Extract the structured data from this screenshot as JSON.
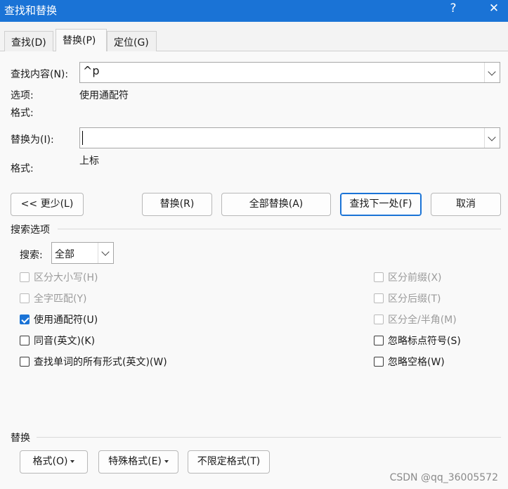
{
  "window": {
    "title": "查找和替换",
    "help_icon": "?",
    "close_icon": "✕"
  },
  "tabs": [
    {
      "label": "查找(D)"
    },
    {
      "label": "替换(P)"
    },
    {
      "label": "定位(G)"
    }
  ],
  "find": {
    "label": "查找内容(N):",
    "value": "^p",
    "options_label": "选项:",
    "options_value": "使用通配符",
    "format_label": "格式:"
  },
  "replace": {
    "label": "替换为(I):",
    "value": "",
    "format_label": "格式:",
    "format_value": "上标"
  },
  "buttons": {
    "less": "<< 更少(L)",
    "replace": "替换(R)",
    "replace_all": "全部替换(A)",
    "find_next": "查找下一处(F)",
    "cancel": "取消"
  },
  "search_options": {
    "title": "搜索选项",
    "search_label": "搜索:",
    "search_value": "全部",
    "left_checks": [
      {
        "label": "区分大小写(H)",
        "checked": false,
        "disabled": true
      },
      {
        "label": "全字匹配(Y)",
        "checked": false,
        "disabled": true
      },
      {
        "label": "使用通配符(U)",
        "checked": true,
        "disabled": false
      },
      {
        "label": "同音(英文)(K)",
        "checked": false,
        "disabled": false
      },
      {
        "label": "查找单词的所有形式(英文)(W)",
        "checked": false,
        "disabled": false
      }
    ],
    "right_checks": [
      {
        "label": "区分前缀(X)",
        "checked": false,
        "disabled": true
      },
      {
        "label": "区分后缀(T)",
        "checked": false,
        "disabled": true
      },
      {
        "label": "区分全/半角(M)",
        "checked": false,
        "disabled": true
      },
      {
        "label": "忽略标点符号(S)",
        "checked": false,
        "disabled": false
      },
      {
        "label": "忽略空格(W)",
        "checked": false,
        "disabled": false
      }
    ]
  },
  "replace_section": {
    "title": "替换",
    "format_button": "格式(O)",
    "special_button": "特殊格式(E)",
    "no_format_button": "不限定格式(T)"
  },
  "watermark": "CSDN @qq_36005572",
  "colors": {
    "titlebar": "#1a73d6",
    "accent": "#1a73d6"
  }
}
